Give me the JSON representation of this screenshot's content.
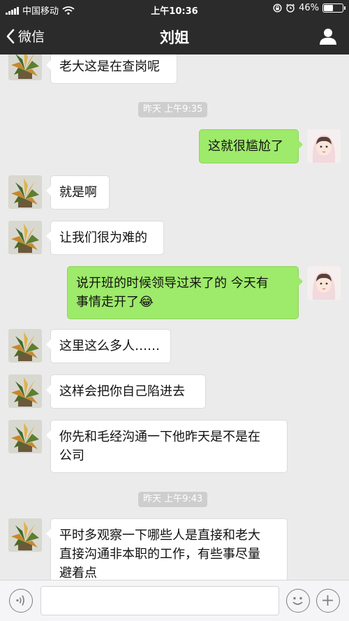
{
  "status_bar": {
    "carrier": "中国移动",
    "time": "上午10:36",
    "battery_text": "46%",
    "battery_level": 0.46
  },
  "nav": {
    "back_label": "微信",
    "title": "刘姐"
  },
  "messages": [
    {
      "side": "in",
      "text": "老大这是在查岗呢"
    },
    {
      "type": "time",
      "text": "昨天 上午9:35"
    },
    {
      "side": "out",
      "text": "这就很尴尬了"
    },
    {
      "side": "in",
      "text": "就是啊"
    },
    {
      "side": "in",
      "text": "让我们很为难的"
    },
    {
      "side": "out",
      "text_line1": "说开班的时候领导过来了的  今天有",
      "text_line2": "事情走开了",
      "emoji": "😂"
    },
    {
      "side": "in",
      "text": "这里这么多人……"
    },
    {
      "side": "in",
      "text": "这样会把你自己陷进去"
    },
    {
      "side": "in",
      "text_line1": "你先和毛经沟通一下他昨天是不是在",
      "text_line2": "公司"
    },
    {
      "type": "time",
      "text": "昨天 上午9:43"
    },
    {
      "side": "in",
      "text_line1": "平时多观察一下哪些人是直接和老大",
      "text_line2": "直接沟通非本职的工作，有些事尽量",
      "text_line3": "避着点"
    }
  ],
  "input": {
    "voice_icon": "voice-icon",
    "emoji_icon": "emoji-icon",
    "plus_icon": "plus-icon"
  },
  "colors": {
    "outgoing_bubble": "#9eea6a",
    "incoming_bubble": "#ffffff",
    "chat_background": "#ebebeb",
    "header": "#2b2b2b"
  }
}
